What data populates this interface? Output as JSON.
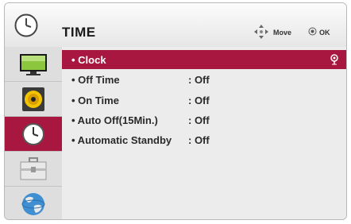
{
  "header": {
    "title": "TIME",
    "move_label": "Move",
    "ok_label": "OK"
  },
  "sidebar": {
    "items": [
      {
        "name": "picture",
        "icon": "tv-screen-icon",
        "active": false
      },
      {
        "name": "audio",
        "icon": "speaker-icon",
        "active": false
      },
      {
        "name": "time",
        "icon": "clock-icon",
        "active": true
      },
      {
        "name": "option",
        "icon": "toolbox-icon",
        "active": false
      },
      {
        "name": "network",
        "icon": "globe-icon",
        "active": false
      }
    ]
  },
  "menu": {
    "items": [
      {
        "label": "• Clock",
        "value": ""
      },
      {
        "label": "• Off Time",
        "value": ": Off"
      },
      {
        "label": "• On Time",
        "value": ": Off"
      },
      {
        "label": "• Auto Off(15Min.)",
        "value": ": Off"
      },
      {
        "label": "• Automatic Standby",
        "value": ": Off"
      }
    ],
    "selected_index": 0
  },
  "colors": {
    "accent": "#a8173f",
    "sidebar_bg": "#dedede",
    "content_bg": "#ececec"
  }
}
